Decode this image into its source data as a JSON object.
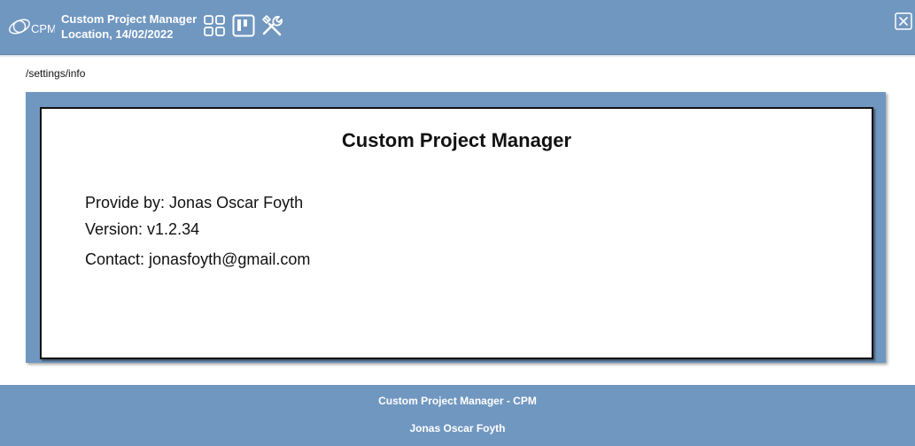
{
  "header": {
    "logo_text": "CPM",
    "title": "Custom Project Manager",
    "subtitle": "Location, 14/02/2022",
    "icons": [
      "grid-icon",
      "kanban-icon",
      "tools-icon"
    ],
    "close_icon": "close-icon"
  },
  "breadcrumb": "/settings/info",
  "info": {
    "title": "Custom Project Manager",
    "provider_label": "Provide by: Jonas Oscar Foyth",
    "version_label": "Version: v1.2.34",
    "contact_label": "Contact: jonasfoyth@gmail.com"
  },
  "footer": {
    "line1": "Custom Project Manager - CPM",
    "line2": "Jonas Oscar Foyth"
  },
  "colors": {
    "primary": "#7097c0",
    "text": "#111111",
    "header_text": "#ffffff"
  }
}
